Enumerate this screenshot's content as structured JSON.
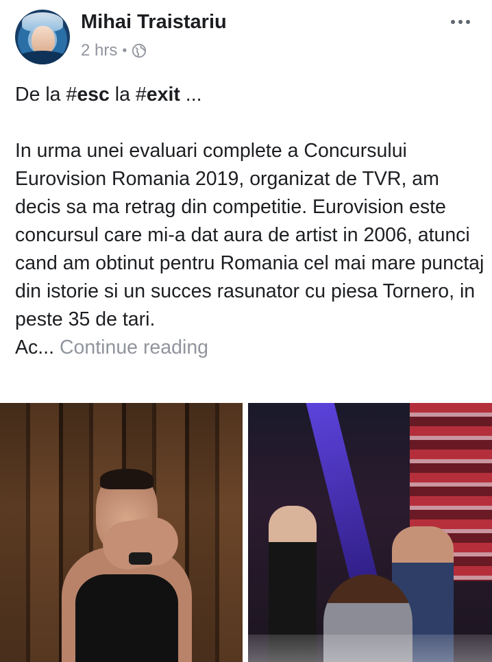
{
  "post": {
    "author": "Mihai Traistariu",
    "time": "2 hrs",
    "separator": "•",
    "privacy_icon": "globe-icon",
    "more_icon": "more-horizontal-icon",
    "text": {
      "line1_prefix1": "De la #",
      "hashtag1": "esc",
      "line1_middle": " la #",
      "hashtag2": "exit",
      "line1_suffix": " ...",
      "paragraph": "In urma unei evaluari complete a Concursului Eurovision Romania 2019, organizat de TVR, am decis sa ma retrag din competitie. Eurovision este concursul care mi-a dat aura de artist in 2006, atunci cand am obtinut pentru Romania cel mai mare punctaj din istorie si un succes rasunator cu piesa Tornero, in peste 35 de tari.",
      "truncated": "Ac...",
      "continue_label": "Continue reading"
    }
  },
  "colors": {
    "text": "#1c1e21",
    "secondary": "#90949c"
  }
}
